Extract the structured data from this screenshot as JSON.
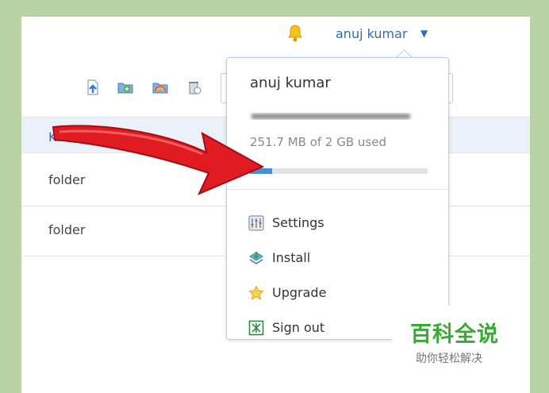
{
  "header": {
    "user_name": "anuj kumar",
    "caret": "▼"
  },
  "toolbar": {
    "icons": [
      "upload-icon",
      "new-folder-icon",
      "shared-folder-icon",
      "deleted-files-icon"
    ]
  },
  "table": {
    "column_header": "Kind",
    "rows": [
      "folder",
      "folder"
    ]
  },
  "account_menu": {
    "name": "anuj kumar",
    "usage_text": "251.7 MB of 2 GB used",
    "usage_fraction": 0.126,
    "items": [
      {
        "label": "Settings",
        "icon": "settings-icon"
      },
      {
        "label": "Install",
        "icon": "install-icon"
      },
      {
        "label": "Upgrade",
        "icon": "star-icon"
      },
      {
        "label": "Sign out",
        "icon": "sign-out-icon"
      }
    ]
  },
  "watermark": {
    "title": "百科全说",
    "subtitle": "助你轻松解决"
  },
  "colors": {
    "link_blue": "#2f6fb0",
    "arrow_red": "#e11b22",
    "watermark_green": "#3aaa35"
  }
}
